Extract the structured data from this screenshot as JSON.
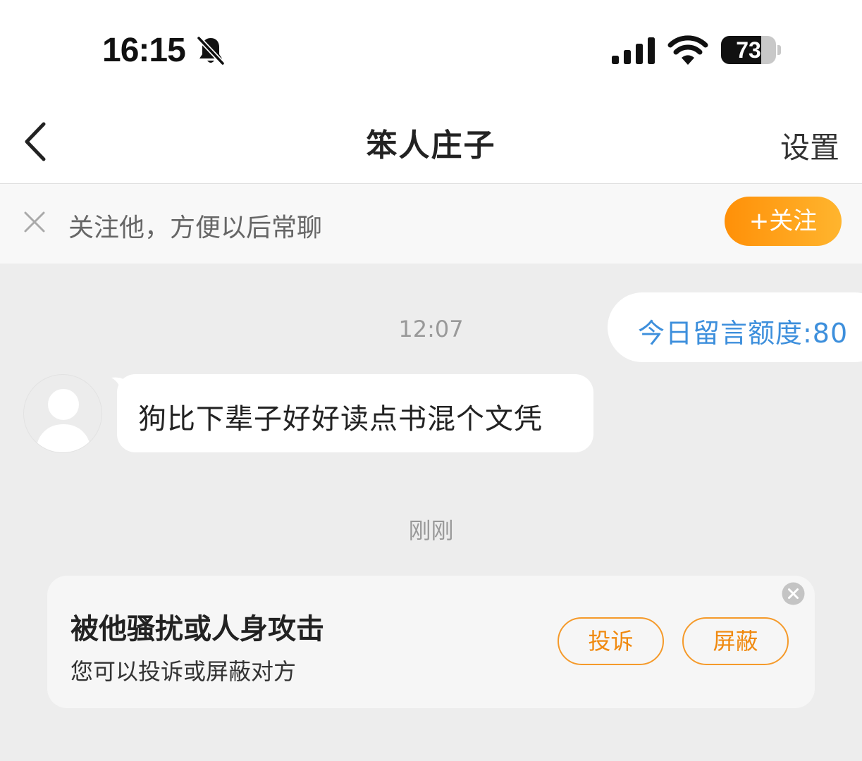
{
  "status_bar": {
    "time": "16:15",
    "battery_level": 73,
    "battery_label": "73",
    "icons": [
      "bell-muted-icon",
      "cellular-signal-icon",
      "wifi-icon",
      "battery-icon"
    ]
  },
  "nav": {
    "title": "笨人庄子",
    "settings_label": "设置",
    "back_icon": "chevron-left-icon"
  },
  "follow_bar": {
    "prompt": "关注他，方便以后常聊",
    "follow_button": "+关注",
    "close_icon": "close-icon"
  },
  "chat": {
    "timestamp_1": "12:07",
    "quota_text": "今日留言额度:80",
    "message": "狗比下辈子好好读点书混个文凭",
    "timestamp_2": "刚刚"
  },
  "harass_card": {
    "title": "被他骚扰或人身攻击",
    "subtitle": "您可以投诉或屏蔽对方",
    "report_label": "投诉",
    "block_label": "屏蔽"
  },
  "colors": {
    "accent_orange": "#ff9a1a",
    "link_blue": "#3d8fdc",
    "chat_background": "#ededed"
  }
}
